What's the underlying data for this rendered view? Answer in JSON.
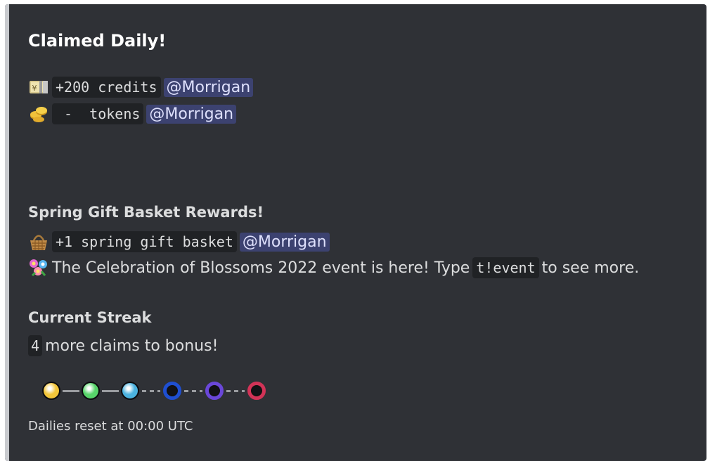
{
  "embed": {
    "title": "Claimed Daily!",
    "accent_color": "#c9cbcf",
    "rewards": [
      {
        "icon": "yen-banknote-icon",
        "code": "+200 credits",
        "mention": "@Morrigan"
      },
      {
        "icon": "coins-icon",
        "code": " -  tokens",
        "mention": "@Morrigan"
      }
    ],
    "event_section": {
      "heading": "Spring Gift Basket Rewards!",
      "reward": {
        "icon": "basket-icon",
        "code": "+1 spring gift basket",
        "mention": "@Morrigan"
      },
      "announcement": {
        "icon": "flowers-icon",
        "text_before": "The Celebration of Blossoms 2022 event is here! Type",
        "command": "t!event",
        "text_after": "to see more."
      }
    },
    "streak_section": {
      "heading": "Current Streak",
      "count": "4",
      "text": "more claims to bonus!",
      "orbs": [
        {
          "name": "yellow-orb-icon",
          "state": "filled",
          "color": "#f3c63a"
        },
        {
          "name": "green-orb-icon",
          "state": "filled",
          "color": "#57d46a"
        },
        {
          "name": "blue-orb-icon",
          "state": "filled",
          "color": "#4bb2df"
        },
        {
          "name": "dark-blue-orb-icon",
          "state": "empty",
          "color": "#1f4fd1"
        },
        {
          "name": "purple-orb-icon",
          "state": "empty",
          "color": "#6a47d9"
        },
        {
          "name": "red-orb-icon",
          "state": "empty",
          "color": "#d23357"
        }
      ]
    },
    "footer": "Dailies reset at 00:00 UTC"
  }
}
